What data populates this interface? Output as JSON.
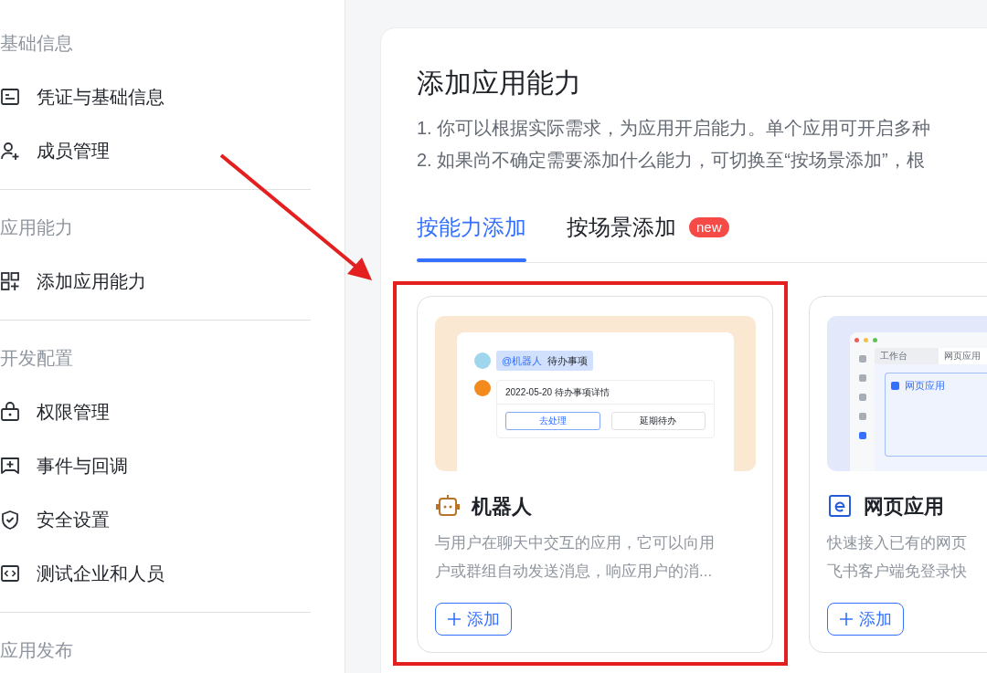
{
  "sidebar": {
    "sections": [
      {
        "heading": "基础信息",
        "items": [
          {
            "label": "凭证与基础信息"
          },
          {
            "label": "成员管理"
          }
        ]
      },
      {
        "heading": "应用能力",
        "items": [
          {
            "label": "添加应用能力"
          }
        ]
      },
      {
        "heading": "开发配置",
        "items": [
          {
            "label": "权限管理"
          },
          {
            "label": "事件与回调"
          },
          {
            "label": "安全设置"
          },
          {
            "label": "测试企业和人员"
          }
        ]
      },
      {
        "heading": "应用发布"
      }
    ]
  },
  "panel": {
    "title": "添加应用能力",
    "description_lines": [
      "1. 你可以根据实际需求，为应用开启能力。单个应用可开启多种",
      "2. 如果尚不确定需要添加什么能力，可切换至“按场景添加”，根"
    ],
    "tabs": [
      {
        "label": "按能力添加",
        "selected": true
      },
      {
        "label": "按场景添加",
        "selected": false,
        "badge": "new"
      }
    ],
    "cards": [
      {
        "kind": "bot",
        "title": "机器人",
        "description_lines": [
          "与用户在聊天中交互的应用，它可以向用",
          "户或群组自动发送消息，响应用户的消..."
        ],
        "button": "添加",
        "preview": {
          "kind": "chat",
          "mention": "@机器人",
          "message": "待办事项",
          "card_title": "2022-05-20 待办事项详情",
          "actions": [
            {
              "label": "去处理",
              "primary": true
            },
            {
              "label": "延期待办",
              "primary": false
            }
          ]
        }
      },
      {
        "kind": "web",
        "title": "网页应用",
        "description_lines": [
          "快速接入已有的网页",
          "飞书客户端免登录快"
        ],
        "button": "添加",
        "preview": {
          "kind": "web",
          "tabs": [
            {
              "label": "工作台",
              "selected": false
            },
            {
              "label": "网页应用",
              "selected": true
            }
          ],
          "content_title": "网页应用"
        }
      }
    ]
  }
}
